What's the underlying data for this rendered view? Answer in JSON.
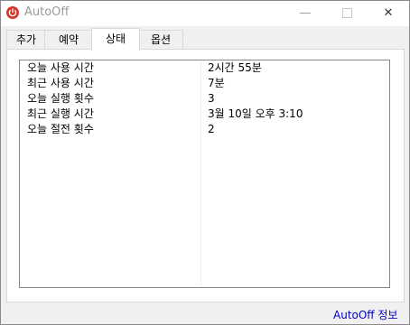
{
  "window": {
    "title": "AutoOff",
    "minimize_glyph": "—",
    "close_glyph": "✕"
  },
  "tabs": [
    {
      "label": "추가",
      "active": false
    },
    {
      "label": "예약",
      "active": false
    },
    {
      "label": "상태",
      "active": true
    },
    {
      "label": "옵션",
      "active": false
    }
  ],
  "status": {
    "rows": [
      {
        "name": "오늘 사용 시간",
        "value": "2시간 55분"
      },
      {
        "name": "최근 사용 시간",
        "value": "7분"
      },
      {
        "name": "오늘 실행 횟수",
        "value": "3"
      },
      {
        "name": "최근 실행 시간",
        "value": "3월 10일 오후 3:10"
      },
      {
        "name": "오늘 절전 횟수",
        "value": "2"
      }
    ]
  },
  "footer": {
    "about_link": "AutoOff 정보"
  },
  "colors": {
    "app_icon": "#d9362b",
    "link": "#0000cc"
  },
  "icons": {
    "app": "power-icon"
  }
}
